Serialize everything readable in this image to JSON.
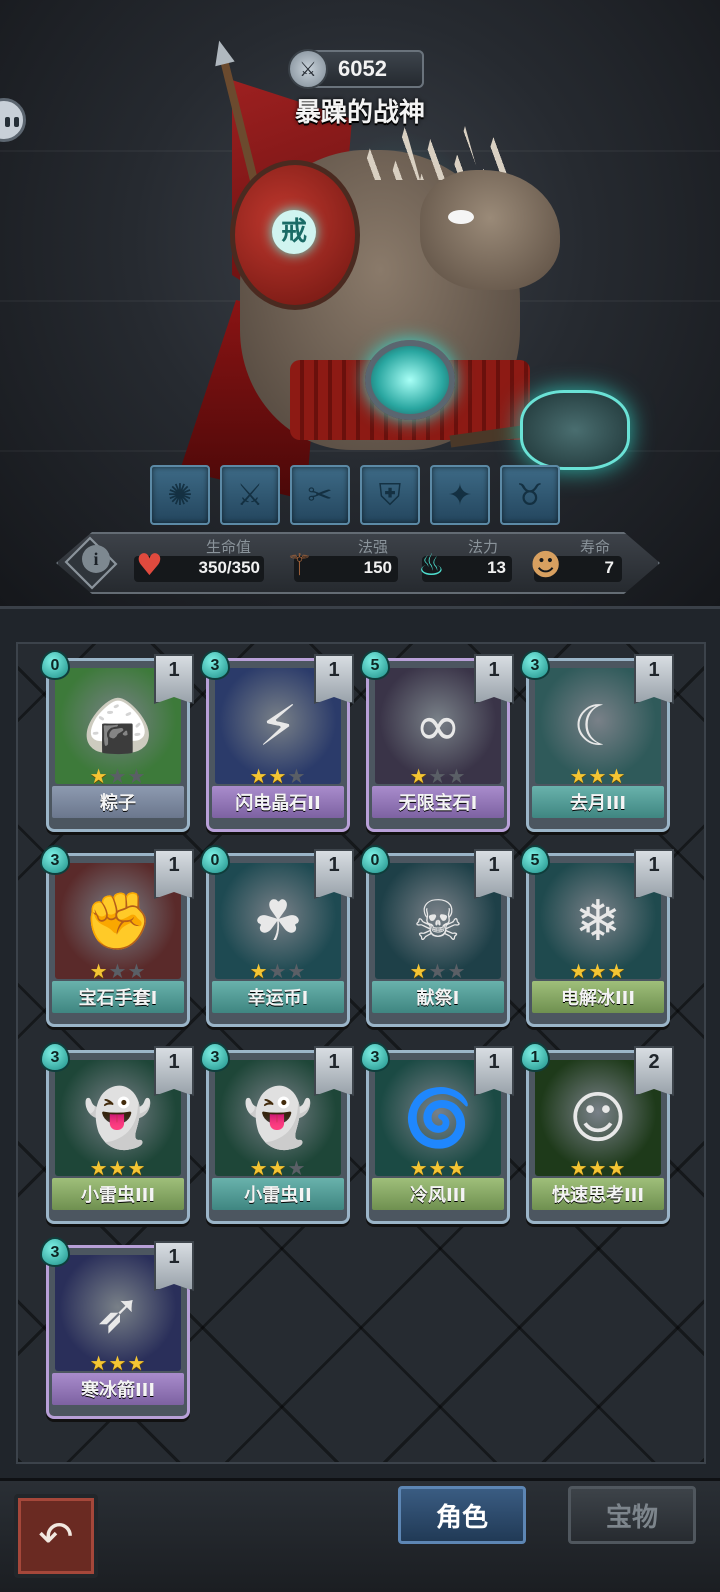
{
  "header": {
    "score": "6052",
    "boss_name": "暴躁的战神",
    "rune_char": "戒"
  },
  "skills": [
    "skill-icon-1",
    "skill-icon-2",
    "skill-icon-3",
    "skill-icon-4",
    "skill-icon-5",
    "skill-icon-6"
  ],
  "stats": {
    "hp_label": "生命值",
    "hp_value": "350/350",
    "power_label": "法强",
    "power_value": "150",
    "mana_label": "法力",
    "mana_value": "13",
    "life_label": "寿命",
    "life_value": "7"
  },
  "cards": [
    {
      "name": "粽子",
      "cost": "0",
      "level": "1",
      "stars": 1,
      "bar": "gray",
      "art": "#3d7a3a",
      "glyph": "🍙"
    },
    {
      "name": "闪电晶石II",
      "cost": "3",
      "level": "1",
      "stars": 2,
      "bar": "purple",
      "art": "#2b3b6a",
      "glyph": "⚡"
    },
    {
      "name": "无限宝石I",
      "cost": "5",
      "level": "1",
      "stars": 1,
      "bar": "purple",
      "art": "#3a3448",
      "glyph": "∞"
    },
    {
      "name": "去月III",
      "cost": "3",
      "level": "1",
      "stars": 3,
      "bar": "teal",
      "art": "#2f5a5a",
      "glyph": "☾"
    },
    {
      "name": "宝石手套I",
      "cost": "3",
      "level": "1",
      "stars": 1,
      "bar": "teal",
      "art": "#5a2a2a",
      "glyph": "✊"
    },
    {
      "name": "幸运币I",
      "cost": "0",
      "level": "1",
      "stars": 1,
      "bar": "teal",
      "art": "#1e4a52",
      "glyph": "☘"
    },
    {
      "name": "献祭I",
      "cost": "0",
      "level": "1",
      "stars": 1,
      "bar": "teal",
      "art": "#1e4048",
      "glyph": "☠"
    },
    {
      "name": "电解冰III",
      "cost": "5",
      "level": "1",
      "stars": 3,
      "bar": "green",
      "art": "#1f4a4e",
      "glyph": "❄"
    },
    {
      "name": "小雷虫III",
      "cost": "3",
      "level": "1",
      "stars": 3,
      "bar": "green",
      "art": "#1e4638",
      "glyph": "👻"
    },
    {
      "name": "小雷虫II",
      "cost": "3",
      "level": "1",
      "stars": 2,
      "bar": "teal",
      "art": "#1e4638",
      "glyph": "👻"
    },
    {
      "name": "冷风III",
      "cost": "3",
      "level": "1",
      "stars": 3,
      "bar": "green",
      "art": "#1b4a44",
      "glyph": "🌀"
    },
    {
      "name": "快速思考III",
      "cost": "1",
      "level": "2",
      "stars": 3,
      "bar": "green",
      "art": "#1e3a1a",
      "glyph": "☺"
    },
    {
      "name": "寒冰箭III",
      "cost": "3",
      "level": "1",
      "stars": 3,
      "bar": "purple",
      "art": "#2a2f5a",
      "glyph": "➶"
    }
  ],
  "nav": {
    "back_icon": "back-arrow-icon",
    "back_glyph": "↶",
    "tab_role": "角色",
    "tab_treasure": "宝物"
  }
}
